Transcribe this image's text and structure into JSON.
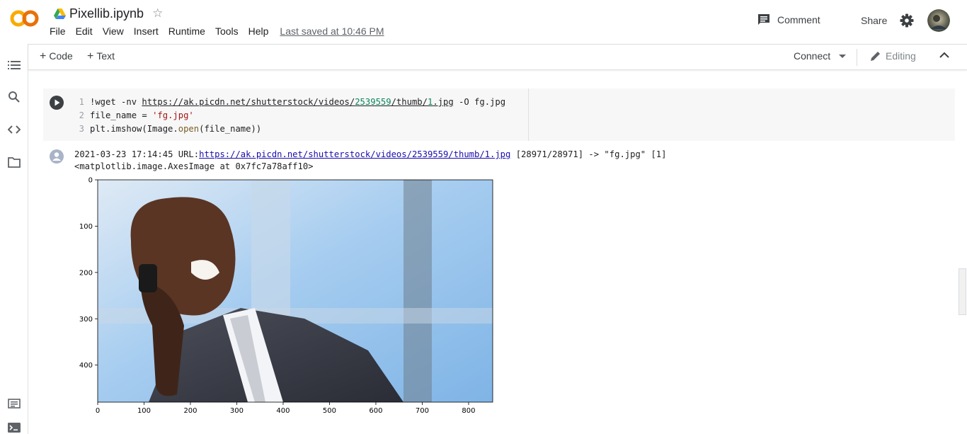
{
  "app": {
    "logo_text": "CO",
    "doc_title": "Pixellib.ipynb",
    "star_glyph": "☆",
    "menu": [
      "File",
      "Edit",
      "View",
      "Insert",
      "Runtime",
      "Tools",
      "Help"
    ],
    "last_saved": "Last saved at 10:46 PM",
    "comment_label": "Comment",
    "share_label": "Share"
  },
  "toolbar": {
    "code_label": "Code",
    "text_label": "Text",
    "connect_label": "Connect",
    "editing_label": "Editing"
  },
  "sidebar": {
    "icons": [
      "toc-icon",
      "search-icon",
      "code-snippets-icon",
      "folder-icon",
      "command-palette-icon",
      "terminal-icon"
    ]
  },
  "cell": {
    "line_numbers": [
      "1",
      "2",
      "3"
    ],
    "line1": {
      "cmd": "!wget -nv ",
      "url_a": "https://ak.picdn.net/shutterstock/videos/",
      "url_num1": "2539559",
      "url_b": "/thumb/",
      "url_num2": "1",
      "url_c": ".jpg",
      "tail": " -O fg.jpg"
    },
    "line2": {
      "code": "file_name = ",
      "str": "'fg.jpg'"
    },
    "line3": {
      "pre": "plt.imshow(Image.",
      "fn": "open",
      "post": "(file_name))"
    }
  },
  "output": {
    "line1_pre": "2021-03-23 17:14:45 URL:",
    "line1_link": "https://ak.picdn.net/shutterstock/videos/2539559/thumb/1.jpg",
    "line1_post": " [28971/28971] -> \"fg.jpg\" [1]",
    "line2": "<matplotlib.image.AxesImage at 0x7fc7a78aff10>"
  },
  "chart_data": {
    "type": "image",
    "x_ticks": [
      "0",
      "100",
      "200",
      "300",
      "400",
      "500",
      "600",
      "700",
      "800"
    ],
    "y_ticks": [
      "0",
      "100",
      "200",
      "300",
      "400"
    ],
    "xlim": [
      0,
      852
    ],
    "ylim": [
      480,
      0
    ]
  },
  "colors": {
    "logo_orange": "#F9AB00",
    "logo_dark_orange": "#E8710A",
    "link": "#1a0dab",
    "number": "#098658",
    "string": "#a31515"
  }
}
